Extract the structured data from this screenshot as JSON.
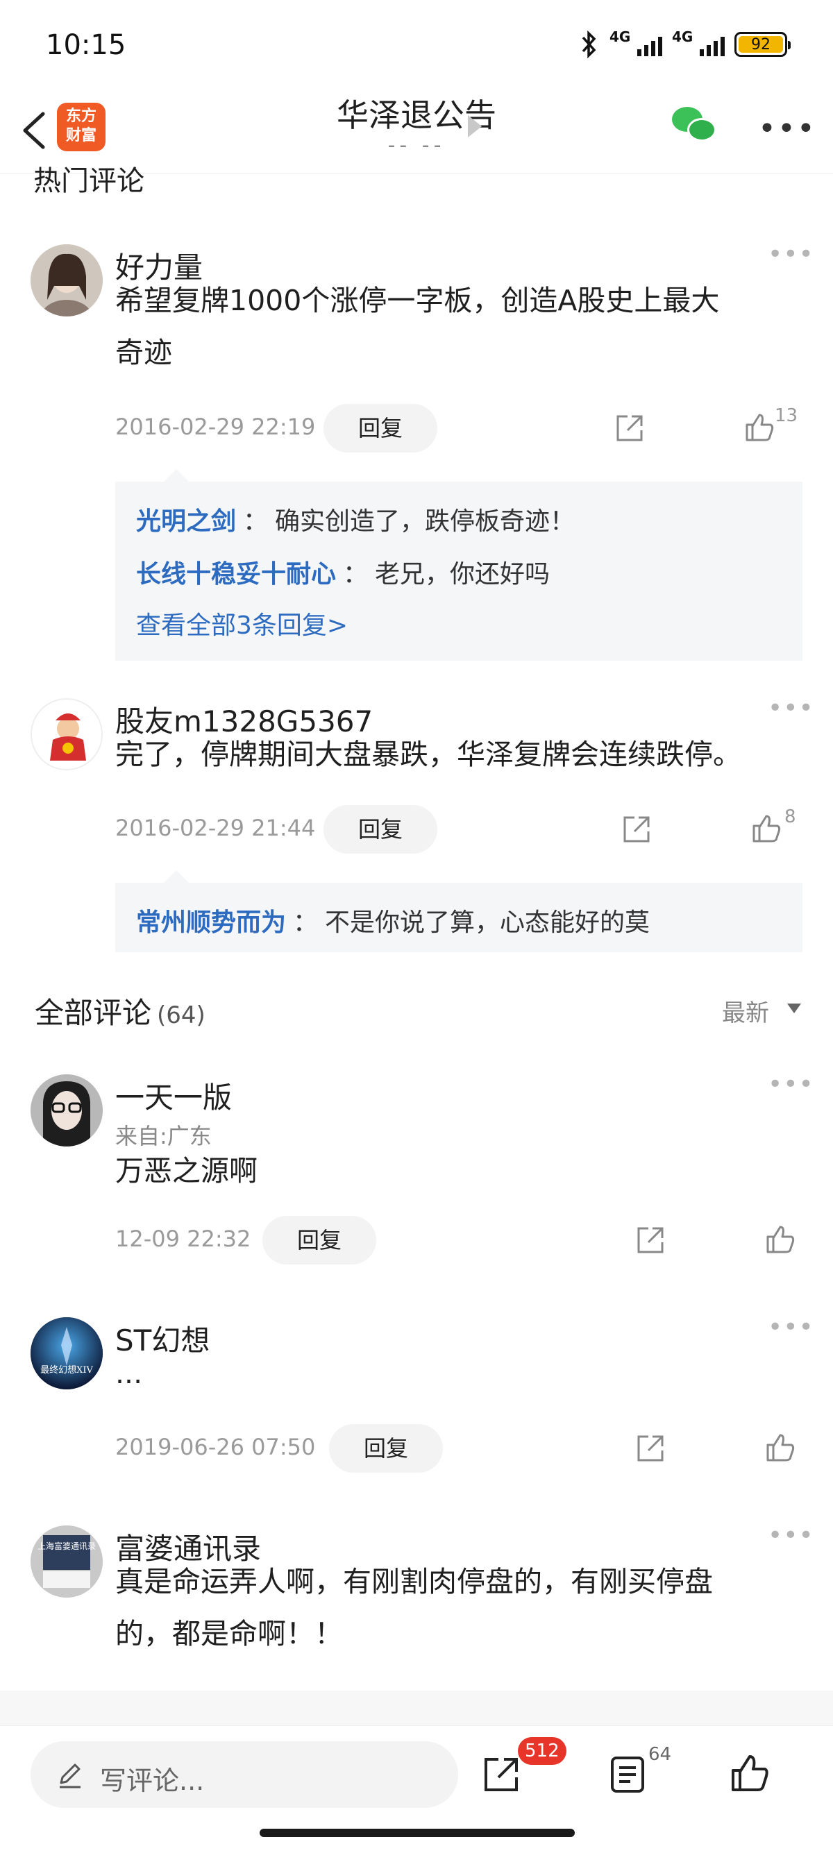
{
  "status_bar": {
    "time": "10:15",
    "network_1": "4G",
    "network_2": "4G",
    "battery": "92"
  },
  "nav": {
    "logo_text_line1": "东方",
    "logo_text_line2": "财富",
    "title": "华泽退公告",
    "subtitle": "-- --"
  },
  "hot_section": {
    "title": "热门评论"
  },
  "hot_comments": [
    {
      "author": "好力量",
      "text_line1": "希望复牌1000个涨停一字板，创造A股史上最大",
      "text_line2": "奇迹",
      "time": "2016-02-29 22:19",
      "reply_label": "回复",
      "likes": "13",
      "replies": [
        {
          "name": "光明之剑",
          "sep": "：",
          "text": "确实创造了，跌停板奇迹！"
        },
        {
          "name": "长线十稳妥十耐心",
          "sep": "：",
          "text": "老兄，你还好吗"
        }
      ],
      "view_all": "查看全部3条回复>"
    },
    {
      "author": "股友m1328G5367",
      "text_line1": "完了，停牌期间大盘暴跌，华泽复牌会连续跌停。",
      "time": "2016-02-29 21:44",
      "reply_label": "回复",
      "likes": "8",
      "replies": [
        {
          "name": "常州顺势而为",
          "sep": "：",
          "text": "不是你说了算，心态能好的莫"
        }
      ]
    }
  ],
  "all_section": {
    "title": "全部评论",
    "count": "(64)",
    "sort_label": "最新"
  },
  "all_comments": [
    {
      "author": "一天一版",
      "origin": "来自:广东",
      "text_line1": "万恶之源啊",
      "time": "12-09 22:32",
      "reply_label": "回复"
    },
    {
      "author": "ST幻想",
      "avatar_text": "最终幻想XIV",
      "text_line1": "...",
      "time": "2019-06-26 07:50",
      "reply_label": "回复"
    },
    {
      "author": "富婆通讯录",
      "avatar_text": "上海富婆通讯录",
      "text_line1": "真是命运弄人啊，有刚割肉停盘的，有刚买停盘",
      "text_line2": "的，都是命啊！！"
    }
  ],
  "bottom_bar": {
    "write_placeholder": "写评论...",
    "share_badge": "512",
    "comment_count": "64"
  },
  "colors": {
    "link_blue": "#2c6bc0",
    "logo_orange": "#f05a24",
    "badge_red": "#e8352a",
    "wechat_green": "#3cc159"
  }
}
